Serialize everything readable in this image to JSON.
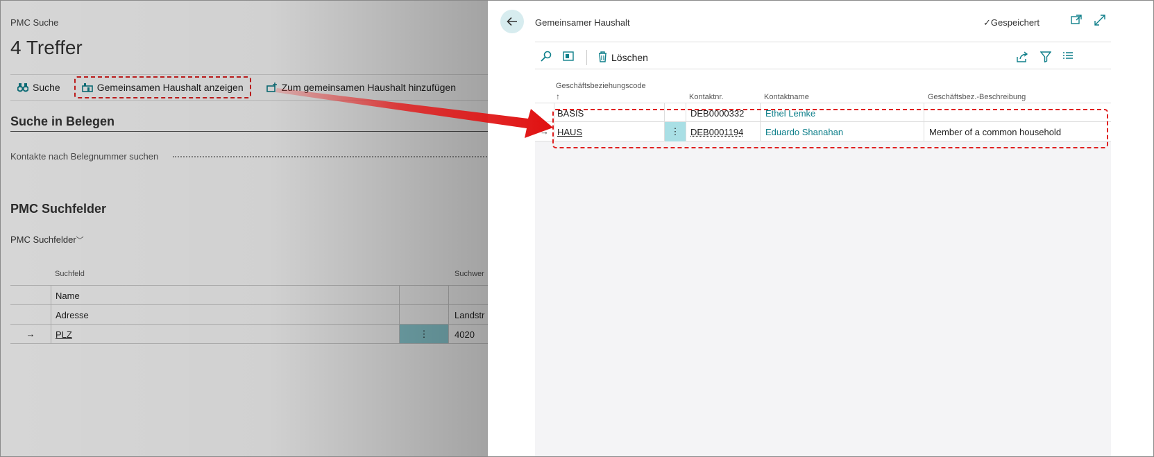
{
  "background_page": {
    "caption": "PMC Suche",
    "title": "4 Treffer",
    "actions": {
      "search": "Suche",
      "show_household": "Gemeinsamen Haushalt anzeigen",
      "add_household": "Zum gemeinsamen Haushalt hinzufügen"
    },
    "section_documents": "Suche in Belegen",
    "documents_field_label": "Kontakte nach Belegnummer suchen",
    "section_fields": "PMC Suchfelder",
    "subsection": "PMC Suchfelder",
    "columns": {
      "field": "Suchfeld",
      "value": "Suchwer"
    },
    "rows": [
      {
        "field": "Name",
        "value": ""
      },
      {
        "field": "Adresse",
        "value": "Landstr"
      },
      {
        "field": "PLZ",
        "value": "4020"
      }
    ],
    "selection_marker": "→",
    "menu_glyph": "⋮"
  },
  "panel": {
    "title": "Gemeinsamer Haushalt",
    "saved_status": "Gespeichert",
    "toolbar": {
      "delete_label": "Löschen"
    },
    "columns": {
      "code": "Geschäftsbeziehungscode",
      "code_sort": "↑",
      "contact_no": "Kontaktnr.",
      "contact_name": "Kontaktname",
      "description": "Geschäftsbez.-Beschreibung"
    },
    "rows": [
      {
        "marker": "",
        "code": "BASIS",
        "contact_no": "DEB0000332",
        "contact_name": "Ethel Lemke",
        "description": ""
      },
      {
        "marker": "→",
        "code": "HAUS",
        "contact_no": "DEB0001194",
        "contact_name": "Eduardo Shanahan",
        "description": "Member of a common household"
      }
    ],
    "menu_glyph": "⋮"
  },
  "icons": {
    "back": "arrow-left-icon",
    "search": "search-icon",
    "edit_list": "edit-list-icon",
    "delete": "trash-icon",
    "share": "share-icon",
    "filter": "filter-icon",
    "list_view": "list-view-icon",
    "open_new": "open-new-window-icon",
    "expand": "expand-icon",
    "checkmark": "checkmark-icon"
  },
  "colors": {
    "accent": "#0e7f8a",
    "annotation": "#e02020",
    "selected_cell": "#a9dfe5"
  }
}
